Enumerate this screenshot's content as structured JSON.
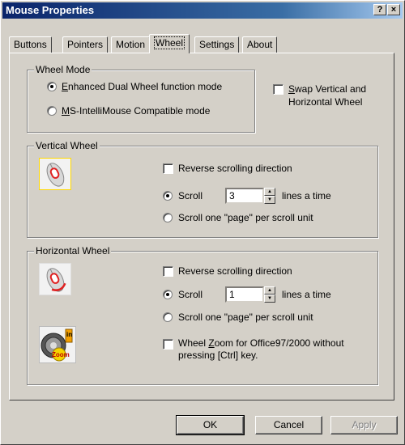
{
  "window": {
    "title": "Mouse Properties",
    "help_label": "?",
    "close_label": "×"
  },
  "tabs": [
    {
      "label": "Buttons"
    },
    {
      "label": "Pointers"
    },
    {
      "label": "Motion"
    },
    {
      "label": "Wheel"
    },
    {
      "label": "Settings"
    },
    {
      "label": "About"
    }
  ],
  "active_tab": "Wheel",
  "wheel_mode": {
    "title": "Wheel Mode",
    "enhanced": {
      "accel": "E",
      "rest": "nhanced Dual Wheel function mode",
      "selected": true
    },
    "intellimouse": {
      "accel": "M",
      "rest": "S-IntelliMouse Compatible mode",
      "selected": false
    },
    "swap_line1": {
      "accel": "S",
      "rest": "wap Vertical and"
    },
    "swap_line2": "Horizontal Wheel"
  },
  "vertical": {
    "title": "Vertical Wheel",
    "reverse_label": "Reverse scrolling direction",
    "scroll_label": "Scroll",
    "scroll_value": "3",
    "lines_label": "lines a time",
    "page_label": "Scroll one \"page\" per scroll unit"
  },
  "horizontal": {
    "title": "Horizontal Wheel",
    "reverse_label": "Reverse scrolling direction",
    "scroll_label": "Scroll",
    "scroll_value": "1",
    "lines_label": "lines a time",
    "page_label": "Scroll one \"page\" per scroll unit",
    "zoom_line1": {
      "pre": "Wheel ",
      "accel": "Z",
      "rest": "oom for Office97/2000 without"
    },
    "zoom_line2": "pressing [Ctrl] key.",
    "zoom_badge": "Zoom",
    "zoom_in": "in"
  },
  "buttons": {
    "ok": "OK",
    "cancel": "Cancel",
    "apply": "Apply"
  }
}
